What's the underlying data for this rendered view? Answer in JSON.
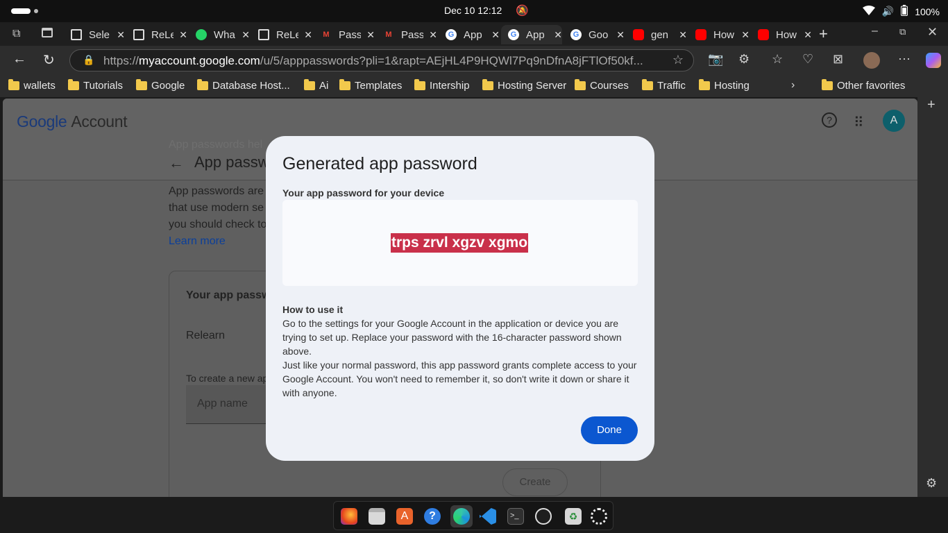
{
  "system": {
    "clock": "Dec 10  12:12",
    "battery": "100%"
  },
  "tabs": [
    {
      "title": "Sele",
      "icon": "doc-icon"
    },
    {
      "title": "ReLe",
      "icon": "doc-icon"
    },
    {
      "title": "Wha",
      "icon": "whatsapp-icon"
    },
    {
      "title": "ReLe",
      "icon": "doc-icon"
    },
    {
      "title": "Pass",
      "icon": "gmail-icon"
    },
    {
      "title": "Pass",
      "icon": "gmail-icon"
    },
    {
      "title": "App",
      "icon": "google-icon"
    },
    {
      "title": "App",
      "icon": "google-icon"
    },
    {
      "title": "Goo",
      "icon": "google-icon"
    },
    {
      "title": "gen",
      "icon": "youtube-icon"
    },
    {
      "title": "How",
      "icon": "youtube-icon"
    },
    {
      "title": "How",
      "icon": "youtube-icon"
    }
  ],
  "url": {
    "prefix": "https://",
    "host": "myaccount.google.com",
    "path": "/u/5/apppasswords?pli=1&rapt=AEjHL4P9HQWl7Pq9nDfnA8jFTlOf50kf..."
  },
  "bookmarks": [
    "wallets",
    "Tutorials",
    "Google",
    "Database Host...",
    "Ai",
    "Templates",
    "Intership",
    "Hosting Server",
    "Courses",
    "Traffic",
    "Hosting",
    "Other favorites"
  ],
  "page": {
    "logo_google": "Google",
    "logo_account": "Account",
    "avatar_letter": "A",
    "faded_top": "App passwords hel",
    "title": "App passw",
    "intro_lines": [
      "App passwords are",
      "that use modern se",
      "you should check to"
    ],
    "learn_more": "Learn more",
    "card_title": "Your app passw",
    "app_entry": "Relearn",
    "create_hint": "To create a new ap",
    "app_name_placeholder": "App name",
    "create_label": "Create"
  },
  "modal": {
    "title": "Generated app password",
    "subtitle": "Your app password for your device",
    "password": "trps zrvl xgzv xgmo",
    "how_title": "How to use it",
    "how_p1": "Go to the settings for your Google Account in the application or device you are trying to set up. Replace your password with the 16-character password shown above.",
    "how_p2": "Just like your normal password, this app password grants complete access to your Google Account. You won't need to remember it, so don't write it down or share it with anyone.",
    "done_label": "Done"
  },
  "colors": {
    "accent_blue": "#0b57d0",
    "highlight": "#c9304a",
    "avatar_bg": "#0f7c8c"
  }
}
